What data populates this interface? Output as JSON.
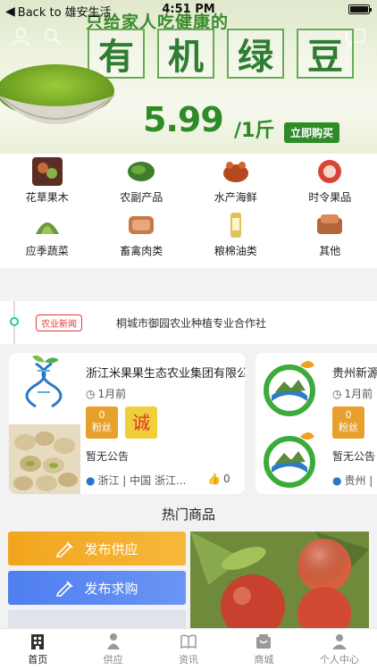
{
  "status_bar": {
    "back_label": "Back to 雄安生活",
    "time": "4:51 PM"
  },
  "banner": {
    "slogan": "只给家人吃健康的",
    "title_chars": [
      "有",
      "机",
      "绿",
      "豆"
    ],
    "price": "5.99",
    "unit": "/1斤",
    "buy_label": "立即购买"
  },
  "categories": [
    {
      "label": "花草果木",
      "color": "#7a3b2a"
    },
    {
      "label": "农副产品",
      "color": "#3e7d2c"
    },
    {
      "label": "水产海鲜",
      "color": "#b4481e"
    },
    {
      "label": "时令果品",
      "color": "#d8443a"
    },
    {
      "label": "应季蔬菜",
      "color": "#6a9a3b"
    },
    {
      "label": "畜禽肉类",
      "color": "#c87948"
    },
    {
      "label": "粮棉油类",
      "color": "#e0c25a"
    },
    {
      "label": "其他",
      "color": "#b5653a"
    }
  ],
  "news": {
    "tag": "农业新闻",
    "text": "桐城市御园农业种植专业合作社"
  },
  "companies": [
    {
      "name": "浙江米果果生态农业集团有限公",
      "time": "1月前",
      "fans_count": "0",
      "fans_label": "粉丝",
      "cheng": "诚",
      "notice": "暂无公告",
      "location": "浙江 | 中国 浙江...",
      "likes": "0"
    },
    {
      "name": "贵州新源",
      "time": "1月前",
      "fans_count": "0",
      "fans_label": "粉丝",
      "notice": "暂无公告",
      "location": "贵州 | 中"
    }
  ],
  "hot": {
    "title": "热门商品",
    "supply_label": "发布供应",
    "demand_label": "发布求购"
  },
  "tabs": [
    {
      "label": "首页",
      "icon": "building-icon"
    },
    {
      "label": "供应",
      "icon": "person-icon"
    },
    {
      "label": "资讯",
      "icon": "book-icon"
    },
    {
      "label": "商城",
      "icon": "store-icon"
    },
    {
      "label": "个人中心",
      "icon": "user-icon"
    }
  ],
  "colors": {
    "accent_green": "#2f8a28",
    "supply_orange": "#f2a51e",
    "demand_blue": "#4f7ff0",
    "news_red": "#e23b3b"
  }
}
